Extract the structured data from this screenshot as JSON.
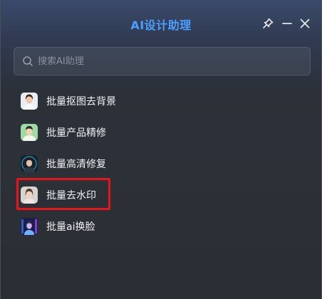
{
  "app": {
    "title": "AI设计助理",
    "accent_color": "#4aa0ff"
  },
  "titlebar": {
    "buttons": [
      {
        "icon": "pin-icon"
      },
      {
        "icon": "minimize-icon"
      },
      {
        "icon": "close-icon"
      }
    ]
  },
  "search": {
    "placeholder": "搜索AI助理",
    "value": "",
    "icon": "search-icon"
  },
  "tools": [
    {
      "label": "批量抠图去背景",
      "avatar": "avatar-woman-white-shirt"
    },
    {
      "label": "批量产品精修",
      "avatar": "avatar-man-green-background"
    },
    {
      "label": "批量高清修复",
      "avatar": "avatar-woman-dark-neon"
    },
    {
      "label": "批量去水印",
      "avatar": "avatar-woman-light",
      "highlighted": true
    },
    {
      "label": "批量ai换脸",
      "avatar": "avatar-figure-blue-neon"
    }
  ],
  "highlight_color": "#e8141a"
}
